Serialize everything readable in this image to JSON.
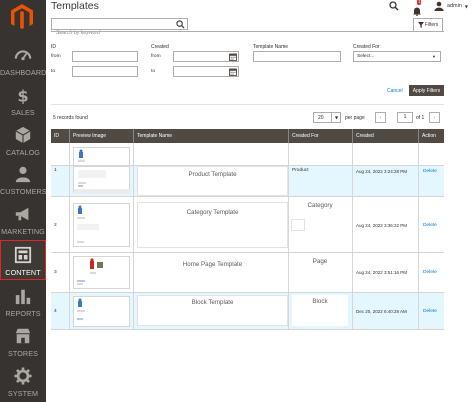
{
  "sidebar": {
    "items": [
      {
        "label": "DASHBOARD",
        "icon": "dashboard-icon"
      },
      {
        "label": "SALES",
        "icon": "dollar-icon"
      },
      {
        "label": "CATALOG",
        "icon": "cube-icon"
      },
      {
        "label": "CUSTOMERS",
        "icon": "customers-icon"
      },
      {
        "label": "MARKETING",
        "icon": "megaphone-icon"
      },
      {
        "label": "CONTENT",
        "icon": "content-icon",
        "active": true
      },
      {
        "label": "REPORTS",
        "icon": "bar-chart-icon"
      },
      {
        "label": "STORES",
        "icon": "store-icon"
      },
      {
        "label": "SYSTEM",
        "icon": "gear-icon"
      }
    ]
  },
  "header": {
    "title": "Templates",
    "notification_count": "1",
    "username": "admin"
  },
  "search": {
    "placeholder": "Search by keyword"
  },
  "filters_tab": "Filters",
  "filters": {
    "id_label": "ID",
    "from_label": "from",
    "to_label": "to",
    "created_label": "Created",
    "template_name_label": "Template Name",
    "created_for_label": "Created For",
    "created_for_value": "Select..."
  },
  "actions": {
    "cancel": "Cancel",
    "apply": "Apply Filters"
  },
  "toolbar": {
    "records_found": "5 records found",
    "per_page_value": "20",
    "per_page_label": "per page",
    "page_current": "1",
    "page_of": "of 1"
  },
  "grid": {
    "columns": [
      "ID",
      "Preview Image",
      "Template Name",
      "Created For",
      "Created",
      "Action"
    ],
    "rows": [
      {
        "id": "",
        "name": "",
        "created_for": "",
        "created": "",
        "action": ""
      },
      {
        "id": "1",
        "name": "Product Template",
        "created_for": "Product",
        "created": "Aug 24, 2022 3:24:28 PM",
        "action": "Delete"
      },
      {
        "id": "2",
        "name": "Category Template",
        "created_for": "Category",
        "created": "Aug 24, 2022 3:36:22 PM",
        "action": "Delete"
      },
      {
        "id": "3",
        "name": "Home Page Template",
        "created_for": "Page",
        "created": "Aug 24, 2022 3:51:16 PM",
        "action": "Delete"
      },
      {
        "id": "4",
        "name": "Block Template",
        "created_for": "Block",
        "created": "Dec 20, 2022 6:40:28 AM",
        "action": "Delete"
      }
    ]
  },
  "colors": {
    "sidebar_bg": "#373330",
    "active_border": "#e22626",
    "header_row": "#514943",
    "link": "#007bdb",
    "alt_row": "#e5f7fe"
  }
}
